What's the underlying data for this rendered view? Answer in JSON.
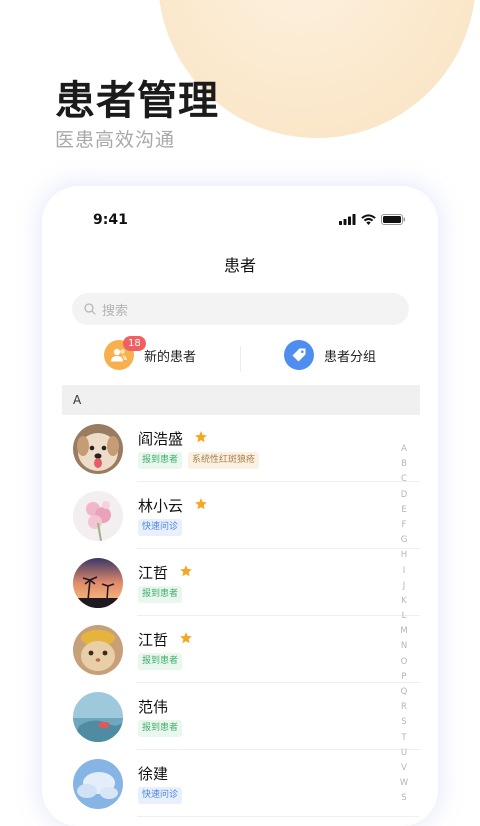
{
  "hero": {
    "title": "患者管理",
    "subtitle": "医患高效沟通"
  },
  "status": {
    "time": "9:41"
  },
  "nav": {
    "title": "患者"
  },
  "search": {
    "placeholder": "搜索"
  },
  "quick": [
    {
      "label": "新的患者",
      "badge": "18",
      "icon": "users-icon",
      "color": "#f7b04c"
    },
    {
      "label": "患者分组",
      "icon": "tag-icon",
      "color": "#4f8ef0"
    }
  ],
  "section": {
    "letter": "A"
  },
  "patients": [
    {
      "name": "阎浩盛",
      "starred": true,
      "tags": [
        {
          "text": "报到患者",
          "style": "green"
        },
        {
          "text": "系统性红斑狼疮",
          "style": "orange"
        }
      ]
    },
    {
      "name": "林小云",
      "starred": true,
      "tags": [
        {
          "text": "快速问诊",
          "style": "blue"
        }
      ]
    },
    {
      "name": "江哲",
      "starred": true,
      "tags": [
        {
          "text": "报到患者",
          "style": "green"
        }
      ]
    },
    {
      "name": "江哲",
      "starred": true,
      "tags": [
        {
          "text": "报到患者",
          "style": "green"
        }
      ]
    },
    {
      "name": "范伟",
      "starred": false,
      "tags": [
        {
          "text": "报到患者",
          "style": "green"
        }
      ]
    },
    {
      "name": "徐建",
      "starred": false,
      "tags": [
        {
          "text": "快速问诊",
          "style": "blue"
        }
      ]
    }
  ],
  "index_letters": [
    "A",
    "B",
    "C",
    "D",
    "E",
    "F",
    "G",
    "H",
    "I",
    "J",
    "K",
    "L",
    "M",
    "N",
    "O",
    "P",
    "Q",
    "R",
    "S",
    "T",
    "U",
    "V",
    "W",
    "S"
  ],
  "colors": {
    "star": "#f5a623",
    "badge": "#f06060"
  }
}
